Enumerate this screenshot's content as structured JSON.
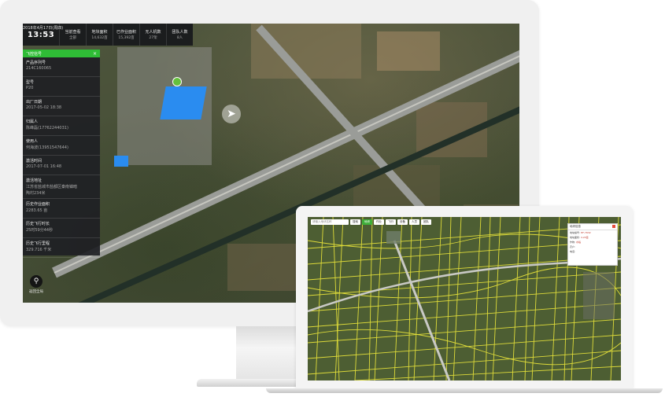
{
  "desktop": {
    "stats": {
      "date": "2018年4月17日(周四)",
      "time": "13:53",
      "items": [
        {
          "label": "当前查看",
          "value": "全部"
        },
        {
          "label": "地块面积",
          "value": "14,632亩"
        },
        {
          "label": "已作业面积",
          "value": "15,392亩"
        },
        {
          "label": "无人机数",
          "value": "27架"
        },
        {
          "label": "团队人数",
          "value": "8人"
        }
      ]
    },
    "panel": {
      "title": "飞控信号",
      "close": "×",
      "rows": [
        {
          "label": "产品序列号",
          "value": "214C160065"
        },
        {
          "label": "型号",
          "value": "P20"
        },
        {
          "label": "出厂日期",
          "value": "2017-05-02 18:38"
        },
        {
          "label": "归属人",
          "value": "陈峰磊(17762244031)"
        },
        {
          "label": "使用人",
          "value": "何海波(13951547644)"
        },
        {
          "label": "激活时间",
          "value": "2017-07-01 16:48"
        },
        {
          "label": "激活地址",
          "value": "江苏省盐城市盐都区秦南镇暗",
          "value2": "陶村234米"
        },
        {
          "label": "历史作业面积",
          "value": "2283.65 亩"
        },
        {
          "label": "历史飞行时长",
          "value": "25时59分44秒"
        },
        {
          "label": "历史飞行里程",
          "value": "329.716 千米"
        }
      ]
    },
    "locate_label": "返回全局"
  },
  "laptop": {
    "search_placeholder": "请输入地块名称",
    "buttons": [
      {
        "label": "搜索",
        "active": false
      },
      {
        "label": "地块",
        "active": true
      },
      {
        "label": "作业",
        "active": false
      },
      {
        "label": "飞行",
        "active": false
      },
      {
        "label": "设备",
        "active": false
      },
      {
        "label": "人员",
        "active": false
      },
      {
        "label": "团队",
        "active": false
      }
    ],
    "popup": {
      "title": "地块信息",
      "rows": [
        {
          "label": "地块编号:",
          "value": "HF-7632"
        },
        {
          "label": "地块面积:",
          "value": "4.20亩"
        },
        {
          "label": "作物:",
          "value": "水稻"
        },
        {
          "label": "农户:",
          "value": ""
        },
        {
          "label": "电话:",
          "value": ""
        }
      ]
    }
  }
}
